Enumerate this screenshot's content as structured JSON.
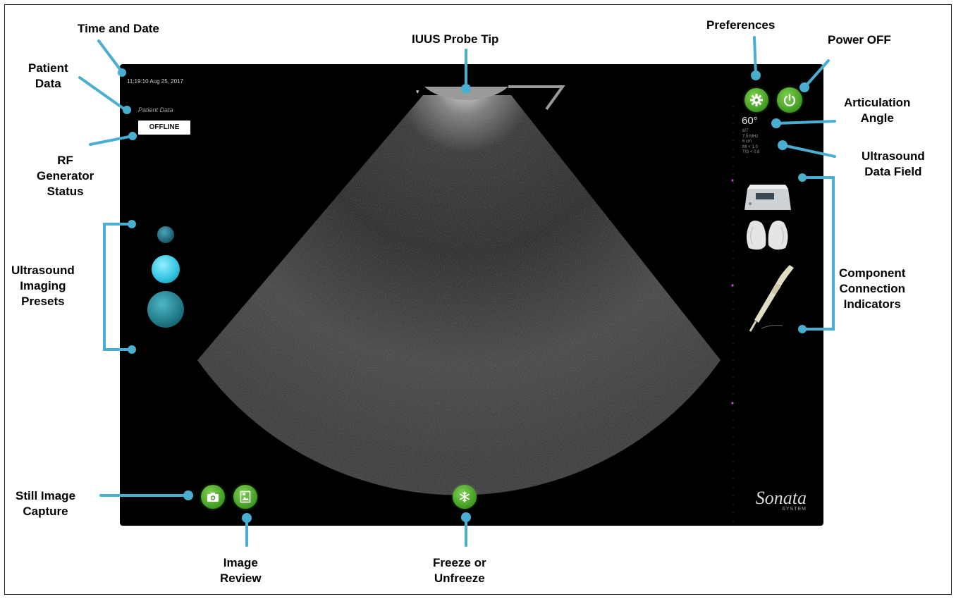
{
  "callouts": {
    "time_date": "Time and Date",
    "patient_data": [
      "Patient",
      "Data"
    ],
    "rf_generator": [
      "RF",
      "Generator",
      "Status"
    ],
    "imaging_presets": [
      "Ultrasound",
      "Imaging",
      "Presets"
    ],
    "still_capture": [
      "Still Image",
      "Capture"
    ],
    "image_review": [
      "Image",
      "Review"
    ],
    "freeze": [
      "Freeze or",
      "Unfreeze"
    ],
    "probe_tip": "IUUS Probe Tip",
    "preferences": "Preferences",
    "power_off": "Power OFF",
    "articulation": [
      "Articulation",
      "Angle"
    ],
    "ultrasound_data": [
      "Ultrasound",
      "Data Field"
    ],
    "component": [
      "Component",
      "Connection",
      "Indicators"
    ]
  },
  "screen": {
    "datetime": "11:19:10 Aug 25, 2017",
    "patient_label": "Patient Data",
    "rf_status": "OFFLINE",
    "angle": "60°",
    "data_field": [
      "6/7",
      "7.5 MHz",
      "6 cm",
      "MI < 1.0",
      "TIS < 0.8"
    ],
    "brand": "Sonata",
    "brand_sub": "SYSTEM"
  },
  "colors": {
    "accent_line": "#4aaed0",
    "button_green": "#4caf2f",
    "preset_cyan": "#38c6e0"
  },
  "icons": {
    "preferences": "gear-icon",
    "power": "power-icon",
    "capture": "camera-icon",
    "review": "image-icon",
    "freeze": "snowflake-icon"
  }
}
